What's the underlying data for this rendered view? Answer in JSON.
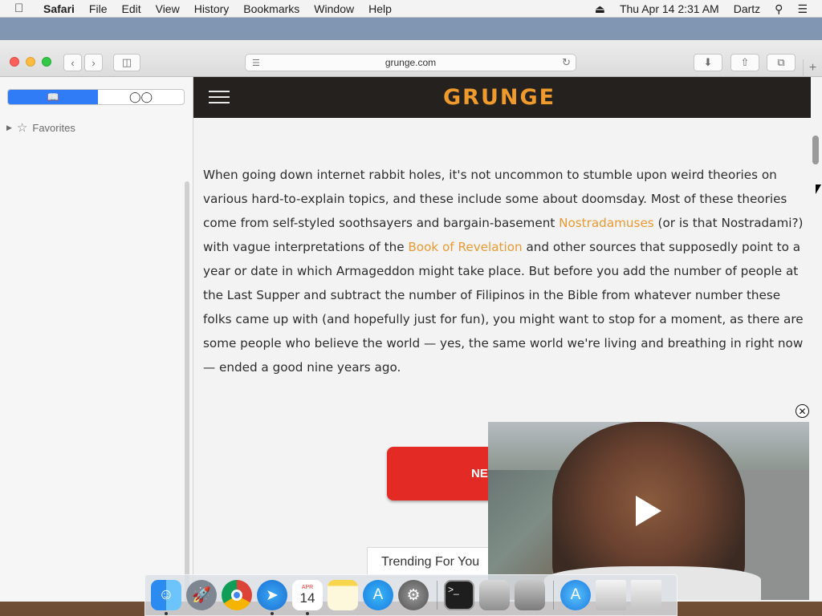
{
  "menubar": {
    "apple": "",
    "items": [
      "Safari",
      "File",
      "Edit",
      "View",
      "History",
      "Bookmarks",
      "Window",
      "Help"
    ],
    "datetime": "Thu Apr 14  2:31 AM",
    "user": "Dartz"
  },
  "toolbar": {
    "url": "grunge.com"
  },
  "sidebar": {
    "favorites_label": "Favorites"
  },
  "site": {
    "logo": "GRUNGE",
    "accent_color": "#ee9a2c"
  },
  "article": {
    "p1": "When going down internet rabbit holes, it's not uncommon to stumble upon weird theories on various hard-to-explain topics, and these include some about doomsday. Most of these theories come from self-styled soothsayers and bargain-basement ",
    "link1": "Nostradamuses",
    "p2": " (or is that Nostradami?) with vague interpretations of the ",
    "link2": "Book of Revelation",
    "p3": " and other sources that supposedly point to a year or date in which Armageddon might take place. But before you add the number of people at the Last Supper and subtract the number of Filipinos in the Bible from whatever number these folks came up with (and hopefully just for fun), you might want to stop for a moment, as there are some people who believe the world — yes, the same world we're living and breathing in right now — ended a good nine years ago."
  },
  "next_button": "NE",
  "trending_label": "Trending For You",
  "dock": {
    "calendar_month": "APR",
    "calendar_day": "14",
    "icons": [
      "finder-icon",
      "launchpad-icon",
      "chrome-icon",
      "safari-icon",
      "calendar-icon",
      "notes-icon",
      "app-store-icon",
      "system-preferences-icon",
      "terminal-icon",
      "disk-utility-icon",
      "archive-utility-icon",
      "app-store-folder-icon",
      "documents-icon",
      "trash-icon"
    ]
  }
}
